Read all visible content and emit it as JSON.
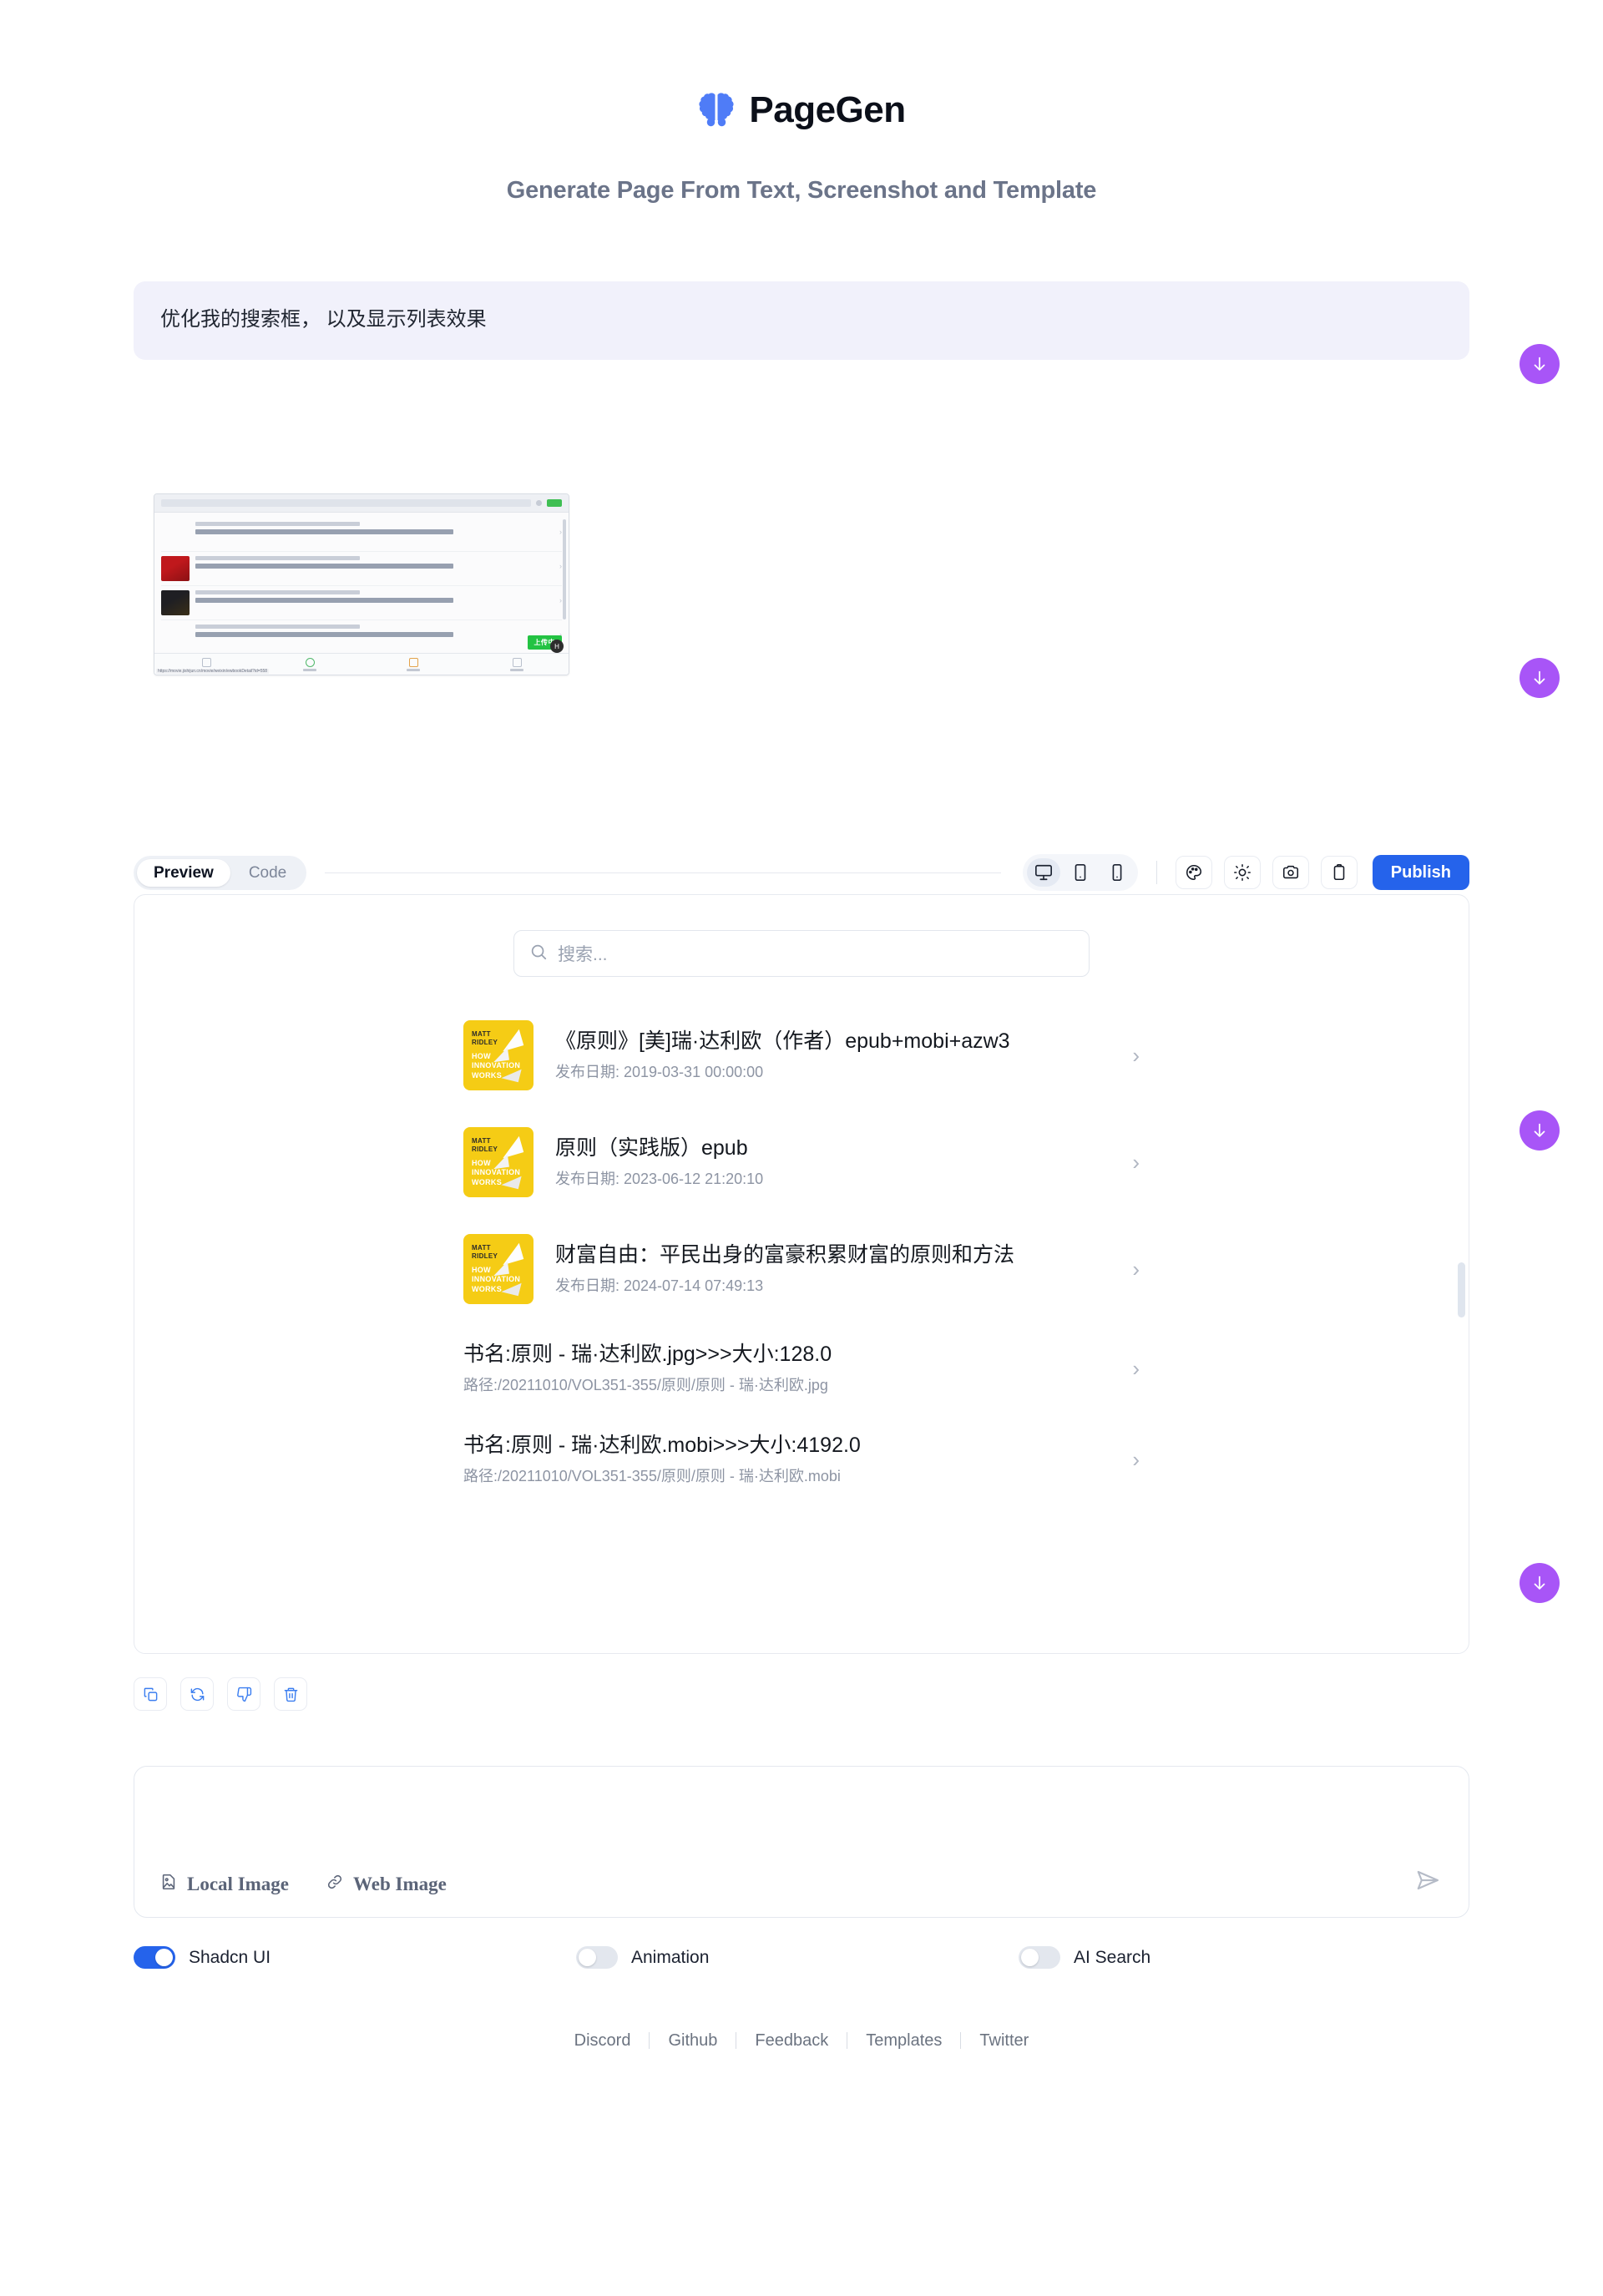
{
  "header": {
    "brand": "PageGen",
    "logo_icon": "brain-icon",
    "tagline": "Generate Page From Text, Screenshot and Template"
  },
  "conversation": {
    "user_prompt": "优化我的搜索框， 以及显示列表效果",
    "attachment_alt": "uploaded-screenshot-thumbnail"
  },
  "attachment_preview": {
    "search_text": "原则",
    "upload_badge": "上传中",
    "url": "https://movie.jishijun.cn/movie/weixin/ewbookDetail?id=558",
    "rows": [
      {
        "sub": "发布日期: 2019-03-31 00:00:00",
        "title": "《原则》[美]瑞·达利欧（作者）epub+mobi+azw3",
        "thumb": "blank"
      },
      {
        "sub": "发布日期: 2023-06-12 21:20:10",
        "title": "原则（实践版）epub",
        "thumb": "red"
      },
      {
        "sub": "发布日期: 2024-07-14 07:49:13",
        "title": "财富自由：平民出身的富豪积累财富的原则和方法",
        "thumb": "dark"
      },
      {
        "sub": "书名:原则 - 瑞·达利欧.jpg>>>大小:128.0",
        "title": "路径:/20211010/VOL351-355/原则/原则 - 瑞·达利欧.jpg",
        "thumb": "blank"
      },
      {
        "sub": "书名:原则 - 瑞·达利欧.mobi>>>大小:4192.0",
        "title": "路径:/20211010/VOL351-355/原则/原则 - 瑞·达利欧.mobi",
        "thumb": "blank"
      }
    ],
    "tabs": [
      "最新",
      "搜索",
      "书籍"
    ]
  },
  "toolbar": {
    "tabs": [
      {
        "label": "Preview",
        "active": true
      },
      {
        "label": "Code",
        "active": false
      }
    ],
    "devices": [
      {
        "name": "desktop-view",
        "icon": "monitor-icon",
        "active": true
      },
      {
        "name": "tablet-view",
        "icon": "tablet-icon",
        "active": false
      },
      {
        "name": "mobile-view",
        "icon": "mobile-icon",
        "active": false
      }
    ],
    "actions": [
      {
        "name": "theme-button",
        "icon": "palette-icon"
      },
      {
        "name": "brightness-button",
        "icon": "sun-icon"
      },
      {
        "name": "screenshot-button",
        "icon": "camera-icon"
      },
      {
        "name": "clipboard-button",
        "icon": "clipboard-icon"
      }
    ],
    "publish_label": "Publish"
  },
  "preview": {
    "search_placeholder": "搜索...",
    "search_icon": "search-icon",
    "items": [
      {
        "title": "《原则》[美]瑞·达利欧（作者）epub+mobi+azw3",
        "subtitle": "发布日期: 2019-03-31 00:00:00",
        "has_thumb": true,
        "thumb_top": "MATT\nRIDLEY",
        "thumb_bottom": "HOW\nINNOVATION\nWORKS"
      },
      {
        "title": "原则（实践版）epub",
        "subtitle": "发布日期: 2023-06-12 21:20:10",
        "has_thumb": true,
        "thumb_top": "MATT\nRIDLEY",
        "thumb_bottom": "HOW\nINNOVATION\nWORKS"
      },
      {
        "title": "财富自由：平民出身的富豪积累财富的原则和方法",
        "subtitle": "发布日期: 2024-07-14 07:49:13",
        "has_thumb": true,
        "thumb_top": "MATT\nRIDLEY",
        "thumb_bottom": "HOW\nINNOVATION\nWORKS"
      },
      {
        "title": "书名:原则 - 瑞·达利欧.jpg>>>大小:128.0",
        "subtitle": "路径:/20211010/VOL351-355/原则/原则 - 瑞·达利欧.jpg",
        "has_thumb": false
      },
      {
        "title": "书名:原则 - 瑞·达利欧.mobi>>>大小:4192.0",
        "subtitle": "路径:/20211010/VOL351-355/原则/原则 - 瑞·达利欧.mobi",
        "has_thumb": false
      }
    ],
    "chevron_icon": "chevron-right-icon"
  },
  "message_actions": [
    {
      "name": "copy-button",
      "icon": "copy-icon"
    },
    {
      "name": "regenerate-button",
      "icon": "refresh-icon"
    },
    {
      "name": "dislike-button",
      "icon": "thumbs-down-icon"
    },
    {
      "name": "delete-button",
      "icon": "trash-icon"
    }
  ],
  "composer": {
    "input_value": "",
    "input_placeholder": "",
    "local_image_label": "Local Image",
    "local_image_icon": "image-file-icon",
    "web_image_label": "Web Image",
    "web_image_icon": "link-icon",
    "send_icon": "send-icon"
  },
  "toggles": [
    {
      "label": "Shadcn UI",
      "on": true
    },
    {
      "label": "Animation",
      "on": false
    },
    {
      "label": "AI Search",
      "on": false
    }
  ],
  "footer": {
    "links": [
      "Discord",
      "Github",
      "Feedback",
      "Templates",
      "Twitter"
    ]
  },
  "float_buttons": {
    "icon": "arrow-down-icon",
    "color": "#a855f7",
    "count": 4
  }
}
